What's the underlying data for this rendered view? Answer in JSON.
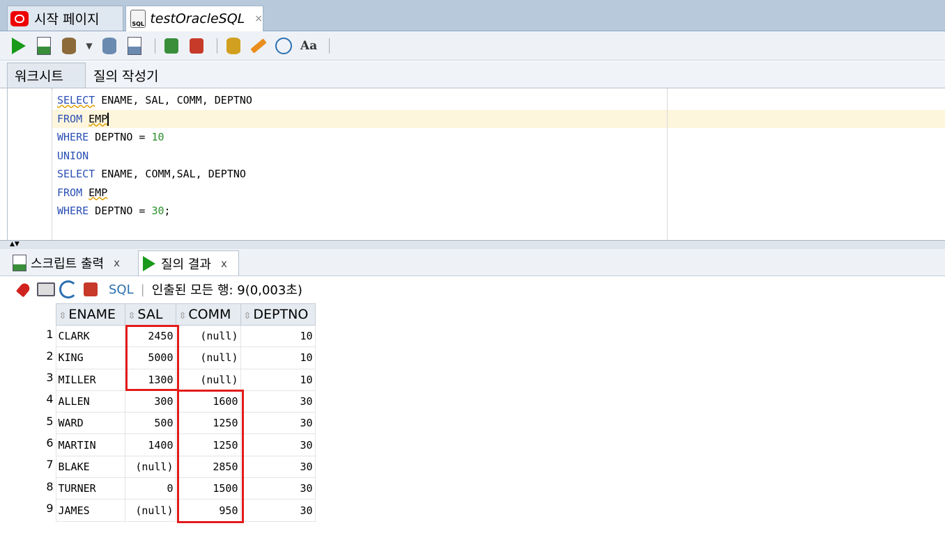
{
  "doc_tabs": [
    {
      "label": "시작 페이지"
    },
    {
      "label": "testOracleSQL"
    }
  ],
  "worksheet_tabs": [
    {
      "label": "워크시트"
    },
    {
      "label": "질의 작성기"
    }
  ],
  "editor": {
    "lines": [
      "SELECT ENAME, SAL, COMM, DEPTNO",
      "FROM EMP",
      "WHERE DEPTNO = 10",
      "UNION",
      "SELECT ENAME, COMM,SAL, DEPTNO",
      "FROM EMP",
      "WHERE DEPTNO = 30;"
    ]
  },
  "output_tabs": [
    {
      "label": "스크립트 출력",
      "close": "x"
    },
    {
      "label": "질의 결과",
      "close": "x"
    }
  ],
  "result_toolbar": {
    "sql_label": "SQL",
    "status": "인출된 모든 행: 9(0,003초)"
  },
  "grid": {
    "columns": [
      "ENAME",
      "SAL",
      "COMM",
      "DEPTNO"
    ],
    "rows": [
      {
        "n": "1",
        "ename": "CLARK",
        "sal": "2450",
        "comm": "(null)",
        "deptno": "10"
      },
      {
        "n": "2",
        "ename": "KING",
        "sal": "5000",
        "comm": "(null)",
        "deptno": "10"
      },
      {
        "n": "3",
        "ename": "MILLER",
        "sal": "1300",
        "comm": "(null)",
        "deptno": "10"
      },
      {
        "n": "4",
        "ename": "ALLEN",
        "sal": "300",
        "comm": "1600",
        "deptno": "30"
      },
      {
        "n": "5",
        "ename": "WARD",
        "sal": "500",
        "comm": "1250",
        "deptno": "30"
      },
      {
        "n": "6",
        "ename": "MARTIN",
        "sal": "1400",
        "comm": "1250",
        "deptno": "30"
      },
      {
        "n": "7",
        "ename": "BLAKE",
        "sal": "(null)",
        "comm": "2850",
        "deptno": "30"
      },
      {
        "n": "8",
        "ename": "TURNER",
        "sal": "0",
        "comm": "1500",
        "deptno": "30"
      },
      {
        "n": "9",
        "ename": "JAMES",
        "sal": "(null)",
        "comm": "950",
        "deptno": "30"
      }
    ]
  },
  "colors": {
    "highlight": "#e31b1b",
    "keyword": "#2a4fb5",
    "number": "#2a8e2a"
  }
}
